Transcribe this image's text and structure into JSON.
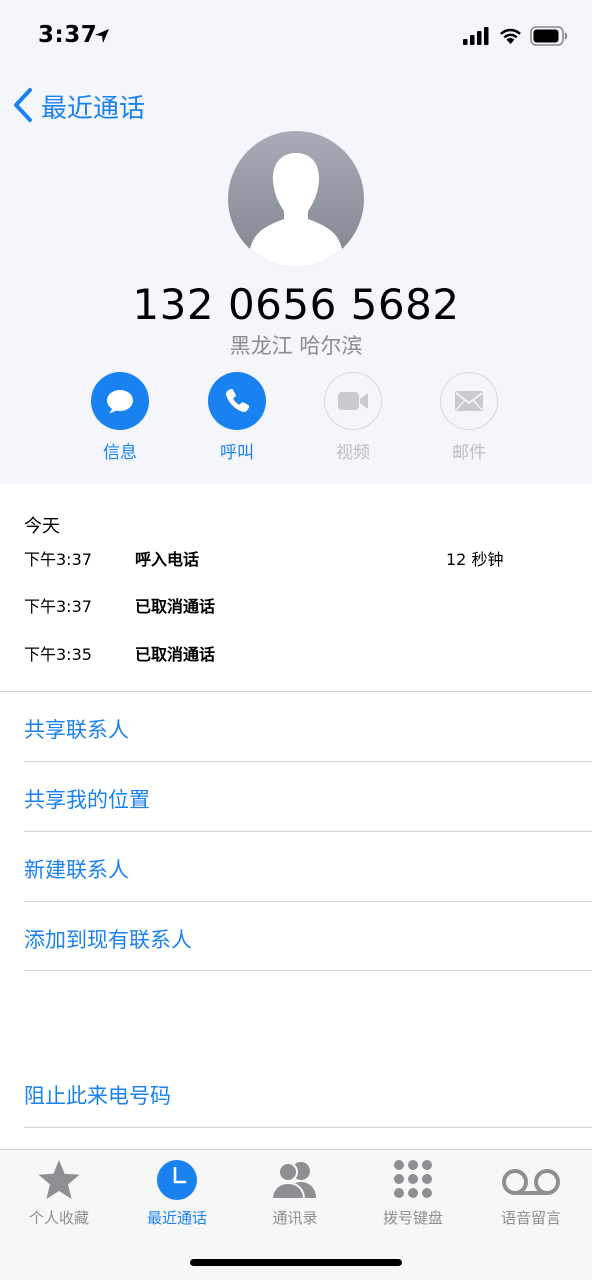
{
  "status_bar": {
    "time": "3:37"
  },
  "nav": {
    "back_label": "最近通话"
  },
  "contact": {
    "number": "132 0656 5682",
    "location": "黑龙江 哈尔滨"
  },
  "actions": [
    {
      "label": "信息",
      "icon": "message-bubble-icon",
      "enabled": true
    },
    {
      "label": "呼叫",
      "icon": "phone-icon",
      "enabled": true
    },
    {
      "label": "视频",
      "icon": "video-camera-icon",
      "enabled": false
    },
    {
      "label": "邮件",
      "icon": "envelope-icon",
      "enabled": false
    }
  ],
  "recents": {
    "section_title": "今天",
    "calls": [
      {
        "time": "下午3:37",
        "type": "呼入电话",
        "duration": "12 秒钟"
      },
      {
        "time": "下午3:37",
        "type": "已取消通话",
        "duration": ""
      },
      {
        "time": "下午3:35",
        "type": "已取消通话",
        "duration": ""
      }
    ]
  },
  "links": {
    "share_contact": "共享联系人",
    "share_location": "共享我的位置",
    "new_contact": "新建联系人",
    "add_to_existing": "添加到现有联系人",
    "block_caller": "阻止此来电号码"
  },
  "tabbar": {
    "items": [
      {
        "label": "个人收藏",
        "icon": "star-icon",
        "active": false
      },
      {
        "label": "最近通话",
        "icon": "clock-icon",
        "active": true
      },
      {
        "label": "通讯录",
        "icon": "contacts-icon",
        "active": false
      },
      {
        "label": "拨号键盘",
        "icon": "keypad-icon",
        "active": false
      },
      {
        "label": "语音留言",
        "icon": "voicemail-icon",
        "active": false
      }
    ]
  },
  "colors": {
    "accent": "#1a82f0",
    "header_bg": "#f4f6fc",
    "muted": "#8e8e93"
  }
}
